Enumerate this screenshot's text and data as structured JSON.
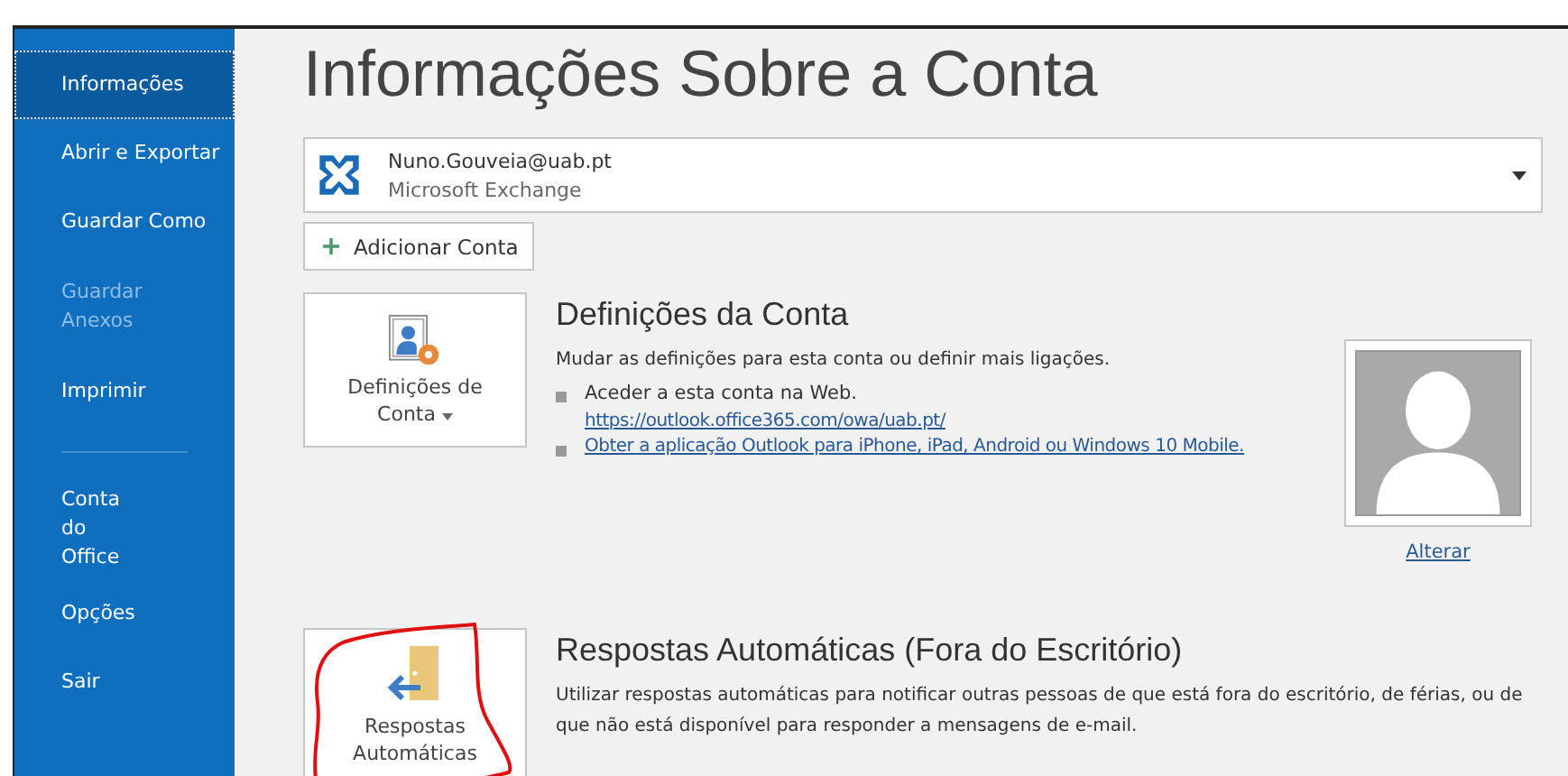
{
  "sidebar": {
    "items": [
      {
        "label": "Informações",
        "selected": true,
        "disabled": false
      },
      {
        "label": "Abrir e Exportar",
        "selected": false,
        "disabled": false
      },
      {
        "label": "Guardar Como",
        "selected": false,
        "disabled": false
      },
      {
        "label": "Guardar Anexos",
        "selected": false,
        "disabled": true
      },
      {
        "label": "Imprimir",
        "selected": false,
        "disabled": false
      },
      {
        "kind": "divider"
      },
      {
        "label": "Conta do Office",
        "selected": false,
        "disabled": false
      },
      {
        "label": "Opções",
        "selected": false,
        "disabled": false
      },
      {
        "label": "Sair",
        "selected": false,
        "disabled": false
      }
    ]
  },
  "page_title": "Informações Sobre a Conta",
  "account": {
    "email": "Nuno.Gouveia@uab.pt",
    "type": "Microsoft Exchange"
  },
  "add_account_button": "Adicionar Conta",
  "sections": [
    {
      "kind": "settings",
      "button": "Definições de Conta",
      "title": "Definições da Conta",
      "description": "Mudar as definições para esta conta ou definir mais ligações.",
      "bullets": [
        {
          "text": "Aceder a esta conta na Web.",
          "link": "https://outlook.office365.com/owa/uab.pt/"
        },
        {
          "link": "Obter a aplicação Outlook para iPhone, iPad, Android ou Windows 10 Mobile."
        }
      ],
      "photo_link": "Alterar"
    },
    {
      "kind": "auto_reply",
      "button": "Respostas Automáticas",
      "title": "Respostas Automáticas (Fora do Escritório)",
      "description": "Utilizar respostas automáticas para notificar outras pessoas de que está fora do escritório, de férias, ou de que não está disponível para responder a mensagens de e-mail.",
      "annotated": true
    }
  ]
}
